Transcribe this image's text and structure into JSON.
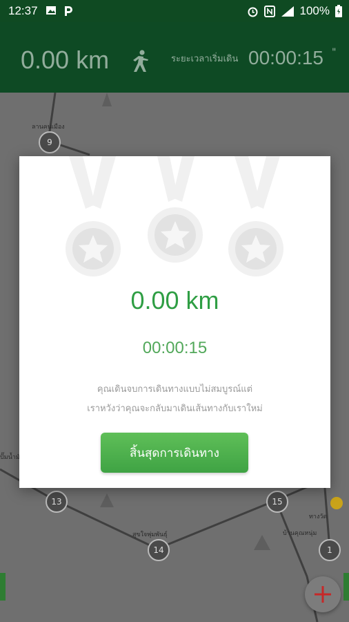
{
  "status_bar": {
    "time": "12:37",
    "battery": "100%",
    "icons": [
      "image-icon",
      "parking-icon",
      "alarm-icon",
      "nfc-icon",
      "signal-icon",
      "battery-icon"
    ]
  },
  "header": {
    "distance": "0.00 km",
    "elapsed_label": "ระยะเวลาเริ่มเดิน",
    "elapsed_time": "00:00:15",
    "trailing_mark": "\""
  },
  "map": {
    "nodes": [
      "9",
      "13",
      "14",
      "15",
      "1"
    ],
    "labels": [
      "ลานคนเมือง",
      "สุขใจพุ่มพันธุ์",
      "บ้านคุณหนุ่ม",
      "ทางวัด",
      "ปั๊มน้ำมัน"
    ]
  },
  "dialog": {
    "distance": "0.00 km",
    "time": "00:00:15",
    "message_line1": "คุณเดินจบการเดินทางแบบไม่สมบูรณ์แต่",
    "message_line2": "เราหวังว่าคุณจะกลับมาเดินเส้นทางกับเราใหม่",
    "end_button": "สิ้นสุดการเดินทาง"
  },
  "colors": {
    "header": "#0e4a24",
    "accent_green": "#2f9e44",
    "button_green": "#4caf50",
    "fab_plus": "#c62828"
  }
}
